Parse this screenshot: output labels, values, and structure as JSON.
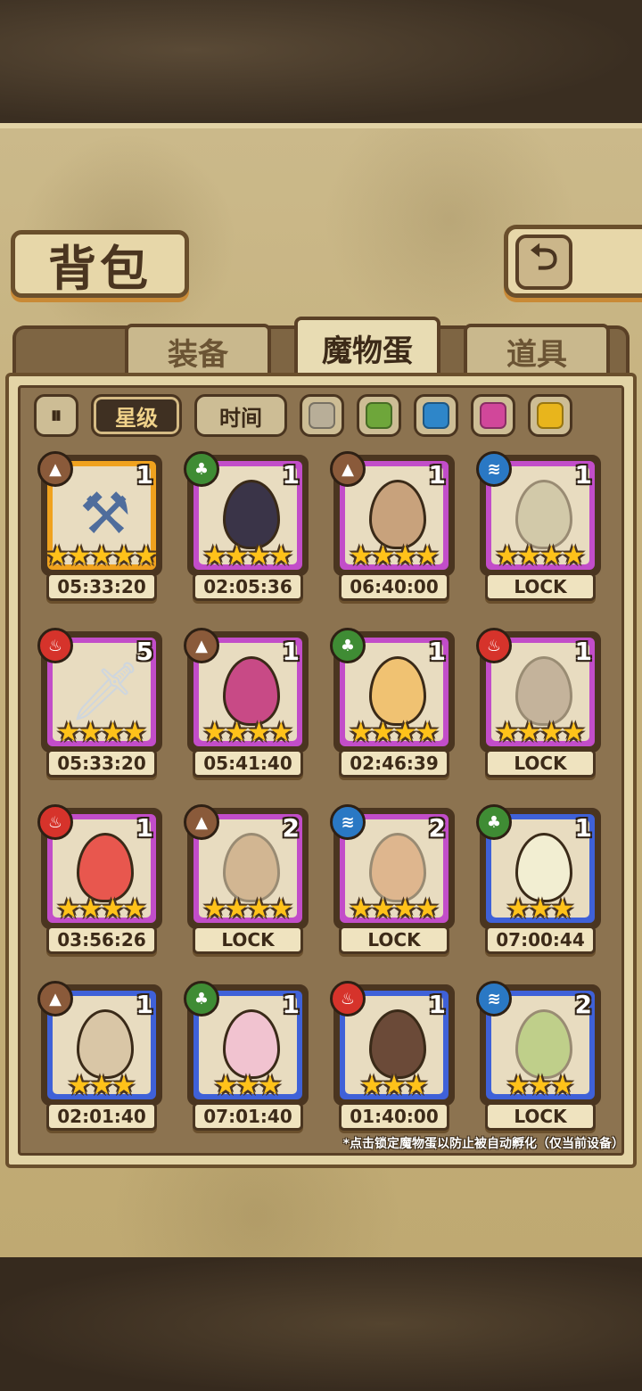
{
  "title": "背包",
  "back_icon": "back-arrow-icon",
  "tabs": [
    {
      "label": "装备",
      "active": false
    },
    {
      "label": "魔物蛋",
      "active": true
    },
    {
      "label": "道具",
      "active": false
    }
  ],
  "filters": {
    "collapse_icon": "collapse-icon",
    "sort_star": "星级",
    "sort_time": "时间",
    "colors": [
      "#b8ae98",
      "#6ea63a",
      "#2e86c9",
      "#d1479a",
      "#e8b51c"
    ]
  },
  "items": [
    {
      "element": "earth",
      "count": "1",
      "stars": 5,
      "rarity": "orange",
      "timer": "05:33:20",
      "art": "hammer"
    },
    {
      "element": "wood",
      "count": "1",
      "stars": 4,
      "rarity": "purple",
      "timer": "02:05:36",
      "art": "spiked-egg"
    },
    {
      "element": "earth",
      "count": "1",
      "stars": 4,
      "rarity": "purple",
      "timer": "06:40:00",
      "art": "furry-egg"
    },
    {
      "element": "water",
      "count": "1",
      "stars": 4,
      "rarity": "purple",
      "timer": "LOCK",
      "art": "leaf-egg"
    },
    {
      "element": "fire",
      "count": "5",
      "stars": 4,
      "rarity": "purple",
      "timer": "05:33:20",
      "art": "dagger"
    },
    {
      "element": "earth",
      "count": "1",
      "stars": 4,
      "rarity": "purple",
      "timer": "05:41:40",
      "art": "thorn-egg"
    },
    {
      "element": "wood",
      "count": "1",
      "stars": 4,
      "rarity": "purple",
      "timer": "02:46:39",
      "art": "feather-egg"
    },
    {
      "element": "fire",
      "count": "1",
      "stars": 4,
      "rarity": "purple",
      "timer": "LOCK",
      "art": "bat-egg"
    },
    {
      "element": "fire",
      "count": "1",
      "stars": 4,
      "rarity": "purple",
      "timer": "03:56:26",
      "art": "kimono-egg"
    },
    {
      "element": "earth",
      "count": "2",
      "stars": 4,
      "rarity": "purple",
      "timer": "LOCK",
      "art": "wood-egg"
    },
    {
      "element": "water",
      "count": "2",
      "stars": 4,
      "rarity": "purple",
      "timer": "LOCK",
      "art": "tribal-egg"
    },
    {
      "element": "wood",
      "count": "1",
      "stars": 3,
      "rarity": "blue",
      "timer": "07:00:44",
      "art": "white-egg"
    },
    {
      "element": "earth",
      "count": "1",
      "stars": 3,
      "rarity": "blue",
      "timer": "02:01:40",
      "art": "hairy-egg"
    },
    {
      "element": "wood",
      "count": "1",
      "stars": 3,
      "rarity": "blue",
      "timer": "07:01:40",
      "art": "lotus-egg"
    },
    {
      "element": "fire",
      "count": "1",
      "stars": 3,
      "rarity": "blue",
      "timer": "01:40:00",
      "art": "horn-egg"
    },
    {
      "element": "water",
      "count": "2",
      "stars": 3,
      "rarity": "blue",
      "timer": "LOCK",
      "art": "green-egg"
    }
  ],
  "hint": "*点击锁定魔物蛋以防止被自动孵化（仅当前设备）"
}
